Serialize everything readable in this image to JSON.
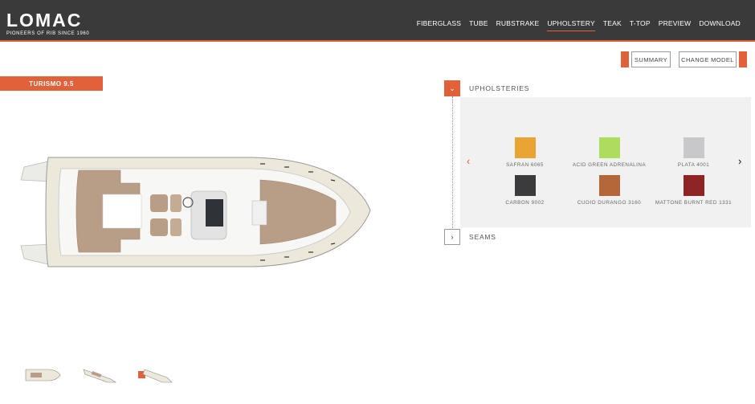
{
  "header": {
    "logo_text": "LOMAC",
    "logo_tagline": "PIONEERS OF RIB SINCE 1960",
    "nav": [
      "FIBERGLASS",
      "TUBE",
      "RUBSTRAKE",
      "UPHOLSTERY",
      "TEAK",
      "T-TOP",
      "PREVIEW",
      "DOWNLOAD"
    ],
    "active_nav": "UPHOLSTERY"
  },
  "actions": {
    "summary_label": "SUMMARY",
    "change_model_label": "CHANGE MODEL"
  },
  "model": {
    "name": "TURISMO 9.5"
  },
  "panel": {
    "upholsteries_title": "UPHOLSTERIES",
    "seams_title": "SEAMS",
    "swatches": [
      {
        "name": "SAFRAN 6065",
        "color": "#e9a433"
      },
      {
        "name": "ACID GREEN ADRENALINA",
        "color": "#aedc5e"
      },
      {
        "name": "PLATA 4001",
        "color": "#c8c8cb"
      },
      {
        "name": "CARBON 9002",
        "color": "#3b3b3d"
      },
      {
        "name": "CUOIO DURANGO 3160",
        "color": "#b4683a"
      },
      {
        "name": "MATTONE BURNT RED 1331",
        "color": "#8e2524"
      }
    ]
  },
  "colors": {
    "accent": "#e0613a",
    "header_bg": "#3a3a3a",
    "panel_bg": "#f1f1f1"
  },
  "views": {
    "thumbnails": [
      "top-view",
      "side-view",
      "rear-view"
    ]
  }
}
